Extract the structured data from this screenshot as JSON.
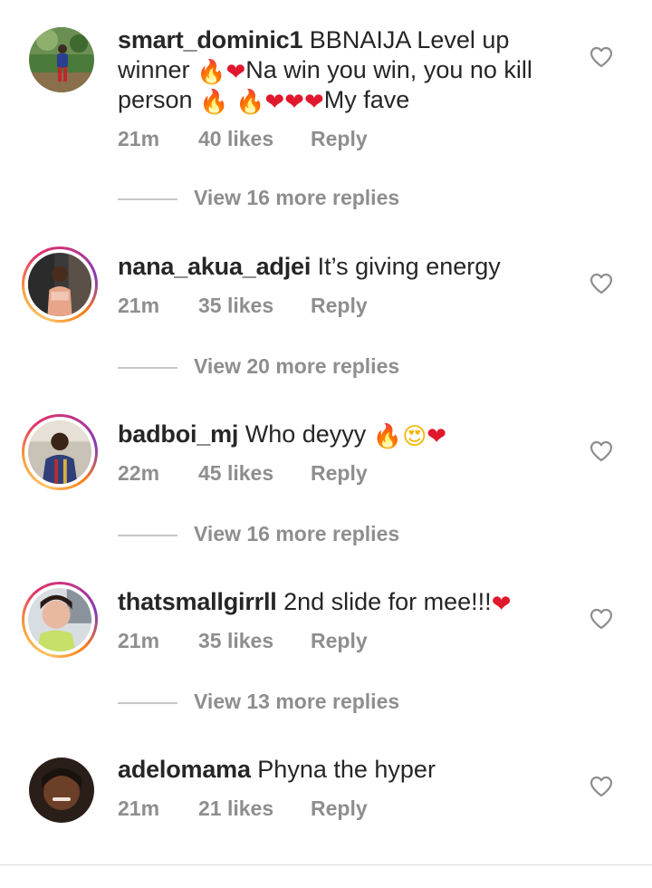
{
  "comments": [
    {
      "username": "smart_dominic1",
      "text_parts": [
        "BBNAIJA Level up winner",
        "Na win you win, you no kill person",
        "My fave"
      ],
      "time": "21m",
      "likes": "40 likes",
      "reply": "Reply",
      "view_replies": "View 16 more replies",
      "avatar_icon": "avatar-photo",
      "has_story_ring": false
    },
    {
      "username": "nana_akua_adjei",
      "text": "It’s giving energy",
      "time": "21m",
      "likes": "35 likes",
      "reply": "Reply",
      "view_replies": "View 20 more replies",
      "avatar_icon": "avatar-photo",
      "has_story_ring": true
    },
    {
      "username": "badboi_mj",
      "text": "Who deyyy",
      "time": "22m",
      "likes": "45 likes",
      "reply": "Reply",
      "view_replies": "View 16 more replies",
      "avatar_icon": "avatar-photo",
      "has_story_ring": true
    },
    {
      "username": "thatsmallgirrll",
      "text": "2nd slide for mee!!!",
      "time": "21m",
      "likes": "35 likes",
      "reply": "Reply",
      "view_replies": "View 13 more replies",
      "avatar_icon": "avatar-photo",
      "has_story_ring": true
    },
    {
      "username": "adelomama",
      "text": "Phyna the hyper",
      "time": "21m",
      "likes": "21 likes",
      "reply": "Reply",
      "avatar_icon": "avatar-photo",
      "has_story_ring": false
    }
  ],
  "emoji": {
    "fire": "🔥",
    "heart": "❤",
    "heart_eyes": "😍"
  },
  "like_icon": "heart-outline-icon",
  "colors": {
    "text_primary": "#262626",
    "text_secondary": "#8e8e8e",
    "divider": "#c7c7c7",
    "heart_red": "#e0182d",
    "fire_orange": "#f57c00",
    "story_ring_start": "#fdc468",
    "story_ring_end": "#c13584"
  }
}
